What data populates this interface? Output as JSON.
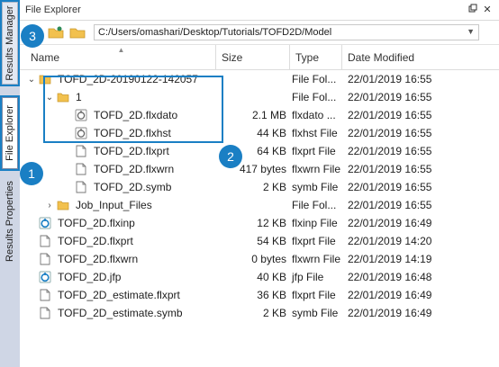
{
  "panel": {
    "title": "File Explorer",
    "pin_glyph": "←",
    "close_glyph": "✕"
  },
  "sidebar": {
    "tabs": [
      {
        "label": "Results Manager"
      },
      {
        "label": "File Explorer"
      },
      {
        "label": "Results Properties"
      }
    ]
  },
  "toolbar": {
    "path": "C:/Users/omashari/Desktop/Tutorials/TOFD2D/Model"
  },
  "columns": {
    "name": "Name",
    "size": "Size",
    "type": "Type",
    "modified": "Date Modified"
  },
  "rows": [
    {
      "name": "TOFD_2D-20190122-142057",
      "size": "",
      "type": "File Fol...",
      "modified": "22/01/2019 16:55",
      "icon": "folder-icon",
      "chevron": "expanded"
    },
    {
      "name": "1",
      "size": "",
      "type": "File Fol...",
      "modified": "22/01/2019 16:55",
      "icon": "folder-icon",
      "chevron": "expanded"
    },
    {
      "name": "TOFD_2D.flxdato",
      "size": "2.1 MB",
      "type": "flxdato ...",
      "modified": "22/01/2019 16:55",
      "icon": "flx-file-icon"
    },
    {
      "name": "TOFD_2D.flxhst",
      "size": "44 KB",
      "type": "flxhst File",
      "modified": "22/01/2019 16:55",
      "icon": "flx-file-icon"
    },
    {
      "name": "TOFD_2D.flxprt",
      "size": "64 KB",
      "type": "flxprt File",
      "modified": "22/01/2019 16:55",
      "icon": "document-icon"
    },
    {
      "name": "TOFD_2D.flxwrn",
      "size": "417 bytes",
      "type": "flxwrn File",
      "modified": "22/01/2019 16:55",
      "icon": "document-icon"
    },
    {
      "name": "TOFD_2D.symb",
      "size": "2 KB",
      "type": "symb File",
      "modified": "22/01/2019 16:55",
      "icon": "document-icon"
    },
    {
      "name": "Job_Input_Files",
      "size": "",
      "type": "File Fol...",
      "modified": "22/01/2019 16:55",
      "icon": "folder-icon",
      "chevron": "collapsed"
    },
    {
      "name": "TOFD_2D.flxinp",
      "size": "12 KB",
      "type": "flxinp File",
      "modified": "22/01/2019 16:49",
      "icon": "flx-blue-icon"
    },
    {
      "name": "TOFD_2D.flxprt",
      "size": "54 KB",
      "type": "flxprt File",
      "modified": "22/01/2019 14:20",
      "icon": "document-icon"
    },
    {
      "name": "TOFD_2D.flxwrn",
      "size": "0 bytes",
      "type": "flxwrn File",
      "modified": "22/01/2019 14:19",
      "icon": "document-icon"
    },
    {
      "name": "TOFD_2D.jfp",
      "size": "40 KB",
      "type": "jfp File",
      "modified": "22/01/2019 16:48",
      "icon": "flx-blue-icon"
    },
    {
      "name": "TOFD_2D_estimate.flxprt",
      "size": "36 KB",
      "type": "flxprt File",
      "modified": "22/01/2019 16:49",
      "icon": "document-icon"
    },
    {
      "name": "TOFD_2D_estimate.symb",
      "size": "2 KB",
      "type": "symb File",
      "modified": "22/01/2019 16:49",
      "icon": "document-icon"
    }
  ],
  "annotations": {
    "badge1": "1",
    "badge2": "2",
    "badge3": "3"
  },
  "colors": {
    "accent": "#1a7fc4",
    "folder": "#f2c14e"
  }
}
